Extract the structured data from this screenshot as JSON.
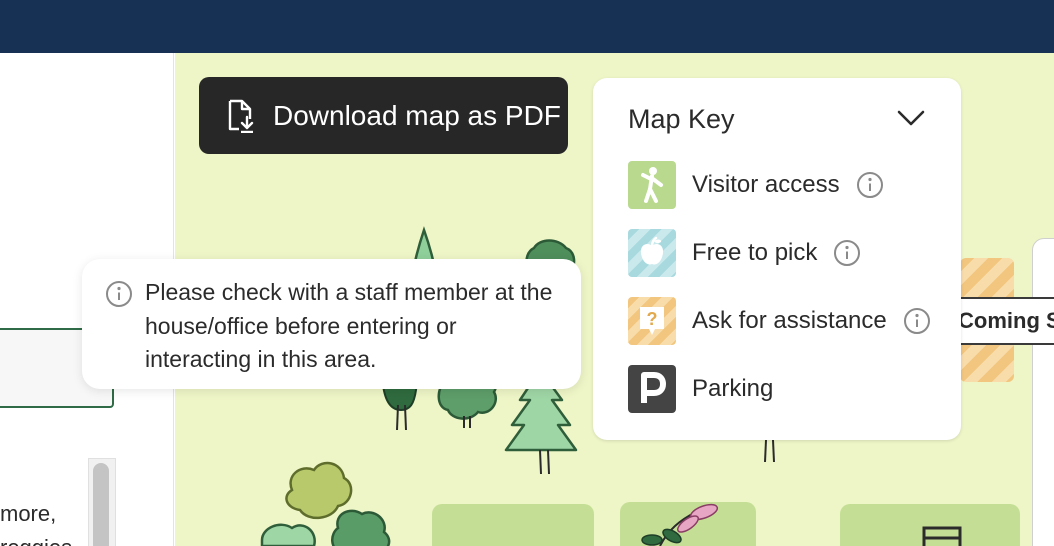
{
  "header": {},
  "left_panel": {
    "text_line1": "more,",
    "text_line2": "reggies"
  },
  "map": {
    "download_button": {
      "label": "Download map as PDF",
      "icon": "file-download-icon"
    },
    "tooltip": {
      "icon": "info-icon",
      "text": "Please check with a staff member at the house/office before entering or interacting in this area."
    },
    "map_key": {
      "title": "Map Key",
      "toggle_icon": "chevron-down-icon",
      "items": [
        {
          "label": "Visitor access",
          "icon": "person-walking-icon",
          "color": "#b9d98f",
          "has_info": true
        },
        {
          "label": "Free to pick",
          "icon": "apple-icon",
          "color": "#a7d9de",
          "has_info": true
        },
        {
          "label": "Ask for assistance",
          "icon": "question-sign-icon",
          "color": "#f2c67e",
          "has_info": true
        },
        {
          "label": "Parking",
          "icon": "parking-icon",
          "color": "#444444",
          "has_info": false
        }
      ]
    },
    "coming_soon_label": "Coming So"
  },
  "colors": {
    "header": "#173155",
    "map_background": "#eef5c7",
    "button_dark": "#272727",
    "border_green": "#2f6b46"
  }
}
